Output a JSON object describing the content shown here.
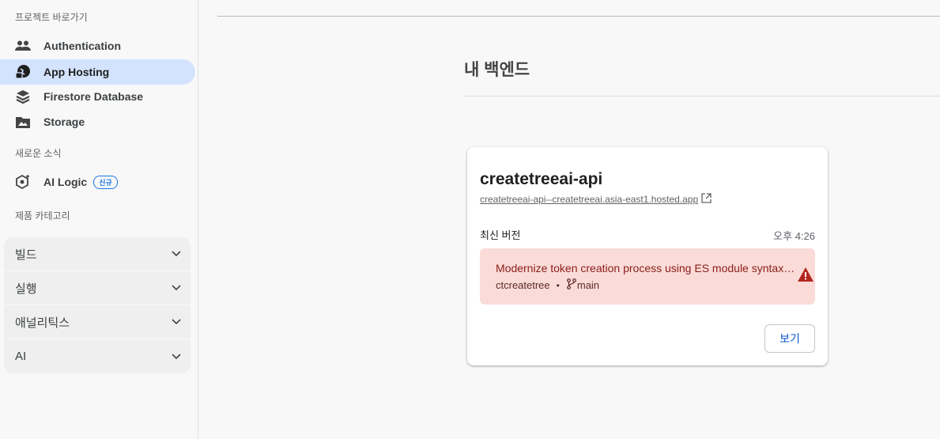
{
  "sidebar": {
    "shortcuts_label": "프로젝트 바로가기",
    "items": [
      {
        "label": "Authentication",
        "icon": "people-icon"
      },
      {
        "label": "App Hosting",
        "icon": "app-hosting-icon"
      },
      {
        "label": "Firestore Database",
        "icon": "firestore-icon"
      },
      {
        "label": "Storage",
        "icon": "storage-icon"
      }
    ],
    "news_label": "새로운 소식",
    "ai_logic": {
      "label": "AI Logic",
      "badge": "신규"
    },
    "categories_label": "제품 카테고리",
    "categories": [
      "빌드",
      "실행",
      "애널리틱스",
      "AI"
    ]
  },
  "main": {
    "title": "내 백엔드",
    "card": {
      "name": "createtreeai-api",
      "url": "createtreeai-api--createtreeai.asia-east1.hosted.app",
      "version_label": "최신 버전",
      "version_time": "오후 4:26",
      "commit_message": "Modernize token creation process using ES module syntax…",
      "author": "ctcreatetree",
      "branch": "main",
      "view_button": "보기"
    }
  },
  "colors": {
    "active_nav_bg": "#d3e3fd",
    "error_bg": "#fadbd8",
    "warning": "#b3261e",
    "link_blue": "#0b57d0"
  }
}
